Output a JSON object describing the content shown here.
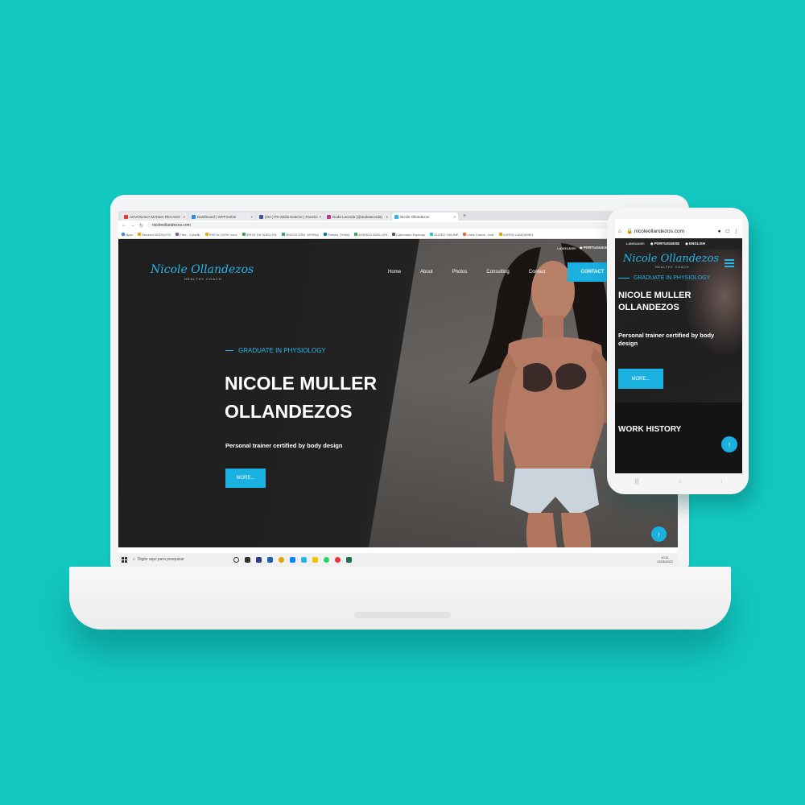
{
  "colors": {
    "background": "#13c8c1",
    "accent": "#1ab0e0",
    "hero_dark": "#1e1e1e"
  },
  "browser": {
    "tabs": [
      {
        "label": "ADVOGADA MANDA RECADO",
        "active": false,
        "favicon_color": "#e33"
      },
      {
        "label": "Dashboard | WPFreebie",
        "active": false,
        "favicon_color": "#2a8ee0"
      },
      {
        "label": "(20+) PH Midia Exterior | Facebo",
        "active": false,
        "favicon_color": "#3b5998"
      },
      {
        "label": "Duda Lacerda (@dudalacerda)",
        "active": false,
        "favicon_color": "#c13584"
      },
      {
        "label": "Nicole Ollandezos",
        "active": true,
        "favicon_color": "#29b6e8"
      }
    ],
    "new_tab": "+",
    "url": "nicoleollandezos.com",
    "bookmarks": [
      "Apps",
      "Servidor NODDUTO",
      "Free - Colorlib",
      "RSS to CMYK conv",
      "DRIVE DA SUELLEN",
      "VÍDEOS DRA. MYRNA",
      "Presets (Trello)",
      "AGENDA SUELLEN",
      "Calendário Exploraç",
      "GUZEO ONLINE",
      "Lives Curtos - Hott",
      "CURSO LANÇAMEN"
    ]
  },
  "site": {
    "logo": "Nicole Ollandezos",
    "logo_tagline": "HEALTHY COACH",
    "language_label": "LANGUAGE:",
    "language_current": "PORTUGUESE",
    "nav": [
      "Home",
      "About",
      "Photos",
      "Consulting",
      "Contact"
    ],
    "contact_button": "CONTACT",
    "hero_subtitle": "GRADUATE IN PHYSIOLOGY",
    "hero_title": "NICOLE MULLER OLLANDEZOS",
    "hero_description": "Personal trainer certified by body design",
    "more_button": "MORE...",
    "scroll_top_icon": "↑"
  },
  "taskbar": {
    "search_placeholder": "Digite aqui para pesquisar",
    "time": "10:11",
    "date": "12/05/2022"
  },
  "phone": {
    "url": "nicoleollandezos.com",
    "language_label": "LANGUAGE:",
    "language_options": [
      "PORTUGUESE",
      "ENGLISH"
    ],
    "logo": "Nicole Ollandezos",
    "logo_tagline": "HEALTHY COACH",
    "hero_subtitle": "GRADUATE IN PHYSIOLOGY",
    "hero_title": "NICOLE MULLER OLLANDEZOS",
    "hero_description": "Personal trainer certified by body design",
    "more_button": "MORE...",
    "section_title": "WORK HISTORY",
    "scroll_top_icon": "↑"
  }
}
